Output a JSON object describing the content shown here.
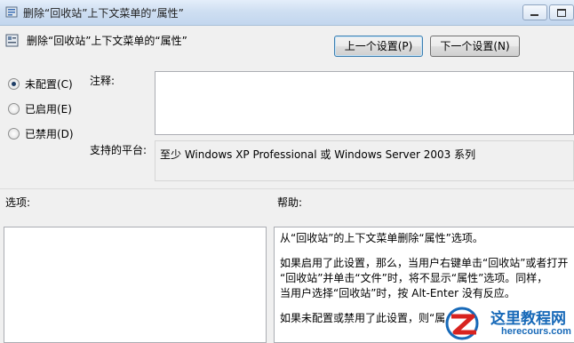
{
  "window": {
    "title": "删除“回收站”上下文菜单的“属性”",
    "minimize_icon": "minimize-icon",
    "maximize_icon": "maximize-icon"
  },
  "header": {
    "policy_title": "删除“回收站”上下文菜单的“属性”",
    "prev_button": "上一个设置(P)",
    "next_button": "下一个设置(N)"
  },
  "state": {
    "options": [
      {
        "label": "未配置(C)",
        "checked": true
      },
      {
        "label": "已启用(E)",
        "checked": false
      },
      {
        "label": "已禁用(D)",
        "checked": false
      }
    ]
  },
  "comment": {
    "label": "注释:",
    "value": ""
  },
  "platform": {
    "label": "支持的平台:",
    "value": "至少 Windows XP Professional 或 Windows Server 2003 系列"
  },
  "sections": {
    "options_label": "选项:",
    "help_label": "帮助:"
  },
  "help": {
    "p1": "从“回收站”的上下文菜单删除“属性”选项。",
    "p2_line1": "如果启用了此设置，那么，当用户右键单击“回收站”或者打开",
    "p2_line2": "“回收站”并单击“文件”时，将不显示“属性”选项。同样，",
    "p2_line3": "当用户选择“回收站”时，按 Alt-Enter 没有反应。",
    "p3": "如果未配置或禁用了此设置，则“属"
  },
  "watermark": {
    "text": "这里教程网",
    "domain": "herecours.com"
  }
}
